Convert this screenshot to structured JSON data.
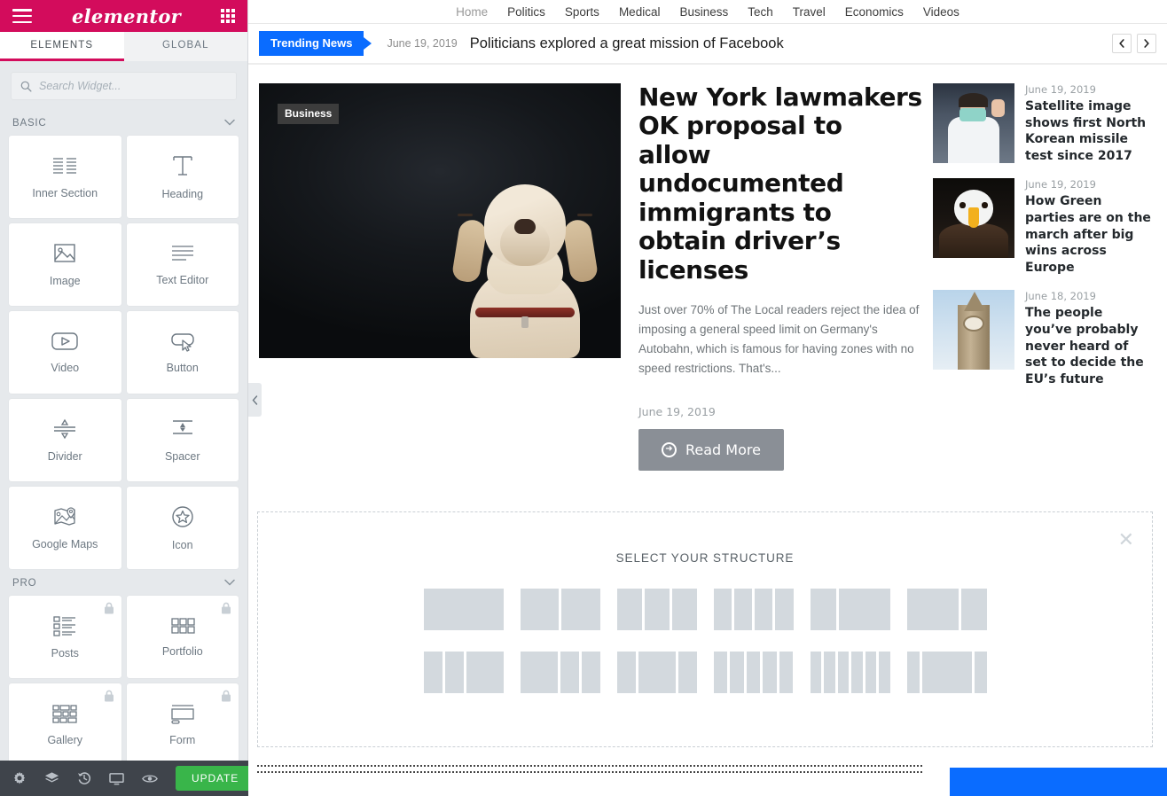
{
  "panel": {
    "brand": "elementor",
    "menu_icon": "hamburger-icon",
    "apps_icon": "grid-icon",
    "tabs": [
      {
        "label": "ELEMENTS",
        "active": true
      },
      {
        "label": "GLOBAL",
        "active": false
      }
    ],
    "search": {
      "placeholder": "Search Widget...",
      "value": "",
      "icon": "search-icon"
    },
    "categories": [
      {
        "name": "BASIC",
        "collapsed": false,
        "widgets": [
          {
            "label": "Inner Section",
            "icon": "inner-section-icon",
            "pro": false
          },
          {
            "label": "Heading",
            "icon": "heading-icon",
            "pro": false
          },
          {
            "label": "Image",
            "icon": "image-icon",
            "pro": false
          },
          {
            "label": "Text Editor",
            "icon": "text-editor-icon",
            "pro": false
          },
          {
            "label": "Video",
            "icon": "video-icon",
            "pro": false
          },
          {
            "label": "Button",
            "icon": "button-icon",
            "pro": false
          },
          {
            "label": "Divider",
            "icon": "divider-icon",
            "pro": false
          },
          {
            "label": "Spacer",
            "icon": "spacer-icon",
            "pro": false
          },
          {
            "label": "Google Maps",
            "icon": "google-maps-icon",
            "pro": false
          },
          {
            "label": "Icon",
            "icon": "star-icon",
            "pro": false
          }
        ]
      },
      {
        "name": "PRO",
        "collapsed": false,
        "widgets": [
          {
            "label": "Posts",
            "icon": "posts-icon",
            "pro": true
          },
          {
            "label": "Portfolio",
            "icon": "portfolio-icon",
            "pro": true
          },
          {
            "label": "Gallery",
            "icon": "gallery-icon",
            "pro": true
          },
          {
            "label": "Form",
            "icon": "form-icon",
            "pro": true
          }
        ]
      }
    ],
    "footer": {
      "icons": [
        "settings-gear-icon",
        "navigator-layers-icon",
        "history-icon",
        "responsive-mode-icon",
        "preview-eye-icon"
      ],
      "update_label": "UPDATE",
      "update_caret_icon": "caret-up-icon"
    },
    "collapse_handle_icon": "chevron-left-icon"
  },
  "preview": {
    "site_nav": [
      {
        "label": "Home",
        "current": true
      },
      {
        "label": "Politics",
        "current": false
      },
      {
        "label": "Sports",
        "current": false
      },
      {
        "label": "Medical",
        "current": false
      },
      {
        "label": "Business",
        "current": false
      },
      {
        "label": "Tech",
        "current": false
      },
      {
        "label": "Travel",
        "current": false
      },
      {
        "label": "Economics",
        "current": false
      },
      {
        "label": "Videos",
        "current": false
      }
    ],
    "trending": {
      "badge": "Trending News",
      "date": "June 19, 2019",
      "headline": "Politicians explored a great mission of Facebook",
      "prev_icon": "chevron-left-icon",
      "next_icon": "chevron-right-icon",
      "badge_color": "#0a6cff"
    },
    "featured": {
      "category_badge": "Business",
      "image_alt": "yellow labrador dog on dark background",
      "title": "New York lawmakers OK proposal to allow undocumented immigrants to obtain driver’s licenses",
      "excerpt": "Just over 70% of The Local readers reject the idea of imposing a general speed limit on Germany's Autobahn, which is famous for having zones with no speed restrictions. That's...",
      "date": "June 19, 2019",
      "read_more_label": "Read More",
      "read_more_icon": "arrow-right-circle-icon",
      "read_more_color": "#8a8f96"
    },
    "side_posts": [
      {
        "date": "June 19, 2019",
        "title": "Satellite image shows first North Korean missile test since 2017",
        "thumb": "th-doctor"
      },
      {
        "date": "June 19, 2019",
        "title": "How Green parties are on the march after big wins across Europe",
        "thumb": "th-eagle"
      },
      {
        "date": "June 18, 2019",
        "title": "The people you’ve probably never heard of set to decide the EU’s future",
        "thumb": "th-bigben"
      }
    ],
    "structure_selector": {
      "title": "SELECT YOUR STRUCTURE",
      "close_icon": "close-icon",
      "rows": [
        [
          [
            1
          ],
          [
            1,
            1
          ],
          [
            1,
            1,
            1
          ],
          [
            1,
            1,
            1,
            1
          ],
          [
            1,
            2
          ],
          [
            2,
            1
          ]
        ],
        [
          [
            1,
            1,
            2
          ],
          [
            2,
            1,
            1
          ],
          [
            1,
            2,
            1
          ],
          [
            1,
            1,
            1,
            1,
            1
          ],
          [
            1,
            1,
            1,
            1,
            1,
            1
          ],
          [
            1,
            4,
            1
          ]
        ]
      ]
    },
    "bottom_block_color": "#0a6cff"
  }
}
